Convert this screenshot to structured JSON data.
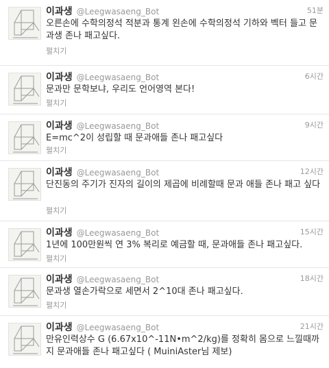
{
  "tweets": [
    {
      "name": "이과생",
      "handle": "@Leegwasaeng_Bot",
      "time": "51분",
      "text": "오른손에 수학의정석 적분과 통계 왼손에 수학의정석 기하와 벡터 들고 문과생 존나 패고싶다.",
      "expand": "펼치기"
    },
    {
      "name": "이과생",
      "handle": "@Leegwasaeng_Bot",
      "time": "6시간",
      "text": "문과만 문학보냐, 우리도 언어영역 본다!",
      "expand": "펼치기"
    },
    {
      "name": "이과생",
      "handle": "@Leegwasaeng_Bot",
      "time": "9시간",
      "text": "E=mc^2이 성립할 때 문과애들 존나 패고싶다",
      "expand": "펼치기"
    },
    {
      "name": "이과생",
      "handle": "@Leegwasaeng_Bot",
      "time": "12시간",
      "text": "단진동의 주기가 진자의 길이의 제곱에 비례할때 문과 애들 존나 패고 싶다",
      "expand": "펼치기"
    },
    {
      "name": "이과생",
      "handle": "@Leegwasaeng_Bot",
      "time": "15시간",
      "text": "1년에 100만원씩 연 3% 복리로 예금할 때, 문과애들 존나 패고싶다.",
      "expand": "펼치기"
    },
    {
      "name": "이과생",
      "handle": "@Leegwasaeng_Bot",
      "time": "18시간",
      "text": "문과생 열손가락으로 세면서 2^10대 존나 패고싶다.",
      "expand": "펼치기"
    },
    {
      "name": "이과생",
      "handle": "@Leegwasaeng_Bot",
      "time": "21시간",
      "text": "만유인력상수 G (6.67x10^-11N•m^2/kg)를 정확히 몸으로 느낄때까지 문과애들 존나 패고싶다 ( MuiniAster님 제보)",
      "expand": ""
    }
  ]
}
